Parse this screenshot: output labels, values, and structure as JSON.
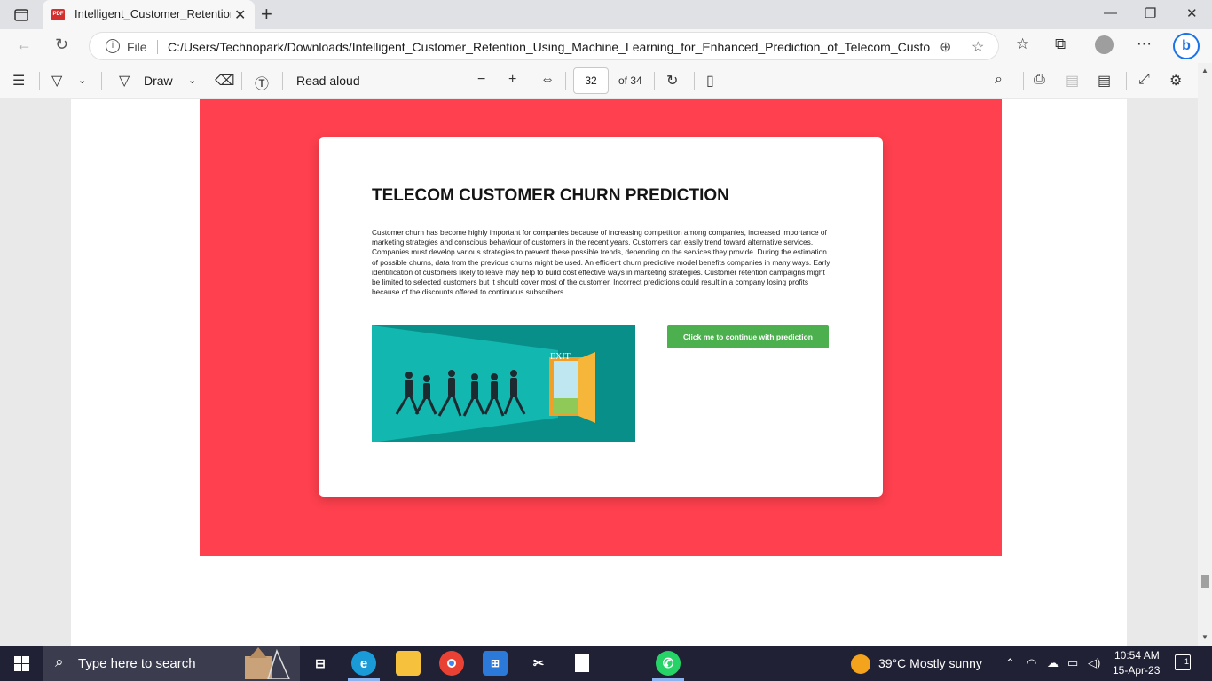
{
  "browser": {
    "tab_title": "Intelligent_Customer_Retention_Using_Machine_Learning_for_Enhanced_Prediction_of_Telecom_Customer_Churn.pdf",
    "tab_icon_label": "PDF",
    "file_label": "File",
    "url": "C:/Users/Technopark/Downloads/Intelligent_Customer_Retention_Using_Machine_Learning_for_Enhanced_Prediction_of_Telecom_Custom..."
  },
  "pdf_toolbar": {
    "draw_label": "Draw",
    "read_aloud_label": "Read aloud",
    "current_page": "32",
    "page_of": "of 34"
  },
  "document": {
    "title": "TELECOM CUSTOMER CHURN PREDICTION",
    "paragraph": "Customer churn has become highly important for companies because of increasing competition among companies, increased importance of marketing strategies and conscious behaviour of customers in the recent years. Customers can easily trend toward alternative services. Companies must develop various strategies to prevent these possible trends, depending on the services they provide. During the estimation of possible churns, data from the previous churns might be used. An efficient churn predictive model benefits companies in many ways. Early identification of customers likely to leave may help to build cost effective ways in marketing strategies. Customer retention campaigns might be limited to selected customers but it should cover most of the customer. Incorrect predictions could result in a company losing profits because of the discounts offered to continuous subscribers.",
    "exit_sign": "EXIT",
    "button_label": "Click me to continue with prediction",
    "colors": {
      "band": "#ff404e",
      "button": "#4cb04e",
      "illustration": "#0aa7a0"
    }
  },
  "taskbar": {
    "search_placeholder": "Type here to search",
    "weather": "39°C  Mostly sunny",
    "time": "10:54 AM",
    "date": "15-Apr-23",
    "notification_count": "1"
  }
}
